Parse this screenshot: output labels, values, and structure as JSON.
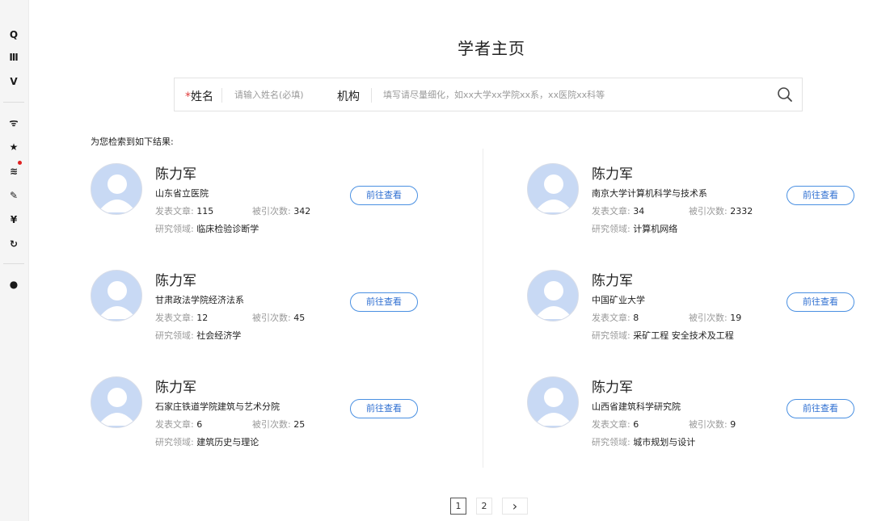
{
  "sidebar": {
    "icons": [
      {
        "name": "search-icon",
        "glyph": "Q"
      },
      {
        "name": "library-icon",
        "glyph": "Ⅲ"
      },
      {
        "name": "v-icon",
        "glyph": "V"
      },
      {
        "name": "rss-icon",
        "glyph": "ᯤ"
      },
      {
        "name": "star-icon",
        "glyph": "★"
      },
      {
        "name": "layers-icon",
        "glyph": "≋"
      },
      {
        "name": "pencil-icon",
        "glyph": "✎"
      },
      {
        "name": "yen-icon",
        "glyph": "¥"
      },
      {
        "name": "refresh-icon",
        "glyph": "↻"
      },
      {
        "name": "user-icon",
        "glyph": "●"
      }
    ],
    "notification_color": "#e02020"
  },
  "page": {
    "title": "学者主页",
    "result_note": "为您检索到如下结果:"
  },
  "search": {
    "required_mark": "*",
    "name_label": "姓名",
    "name_placeholder": "请输入姓名(必填)",
    "org_label": "机构",
    "org_placeholder": "填写请尽量细化，如xx大学xx学院xx系，xx医院xx科等"
  },
  "labels": {
    "articles": "发表文章:",
    "citations": "被引次数:",
    "field": "研究领域:",
    "view": "前往查看"
  },
  "scholars": [
    {
      "name": "陈力军",
      "institution": "山东省立医院",
      "articles": "115",
      "citations": "342",
      "field": "临床检验诊断学"
    },
    {
      "name": "陈力军",
      "institution": "南京大学计算机科学与技术系",
      "articles": "34",
      "citations": "2332",
      "field": "计算机网络"
    },
    {
      "name": "陈力军",
      "institution": "甘肃政法学院经济法系",
      "articles": "12",
      "citations": "45",
      "field": "社会经济学"
    },
    {
      "name": "陈力军",
      "institution": "中国矿业大学",
      "articles": "8",
      "citations": "19",
      "field": "采矿工程 安全技术及工程"
    },
    {
      "name": "陈力军",
      "institution": "石家庄铁道学院建筑与艺术分院",
      "articles": "6",
      "citations": "25",
      "field": "建筑历史与理论"
    },
    {
      "name": "陈力军",
      "institution": "山西省建筑科学研究院",
      "articles": "6",
      "citations": "9",
      "field": "城市规划与设计"
    }
  ],
  "pagination": {
    "pages": [
      "1",
      "2"
    ],
    "current": "1",
    "next": "›"
  },
  "colors": {
    "accent": "#4a90e2",
    "avatar_bg": "#c8d9f4",
    "required": "#e03c3c"
  }
}
